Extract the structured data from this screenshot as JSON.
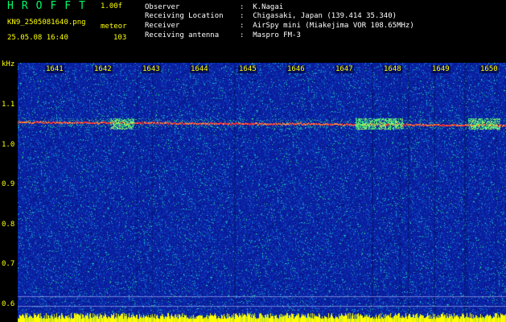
{
  "header": {
    "app_title": "HROFFT",
    "version": "1.00f",
    "filename": "KN9_2505081640.png",
    "mode": "meteor",
    "datetime": "25.05.08 16:40",
    "count": "103"
  },
  "info": [
    {
      "label": "Observer",
      "value": ":  K.Nagai"
    },
    {
      "label": "Receiving Location",
      "value": ":  Chigasaki, Japan (139.414 35.340)"
    },
    {
      "label": "Receiver",
      "value": ":  AirSpy mini (Miakejima VOR 108.65MHz)"
    },
    {
      "label": "Receiving antenna",
      "value": ":  Maspro FM-3"
    }
  ],
  "axis": {
    "y_unit": "kHz",
    "x_ticks": [
      "1641",
      "1642",
      "1643",
      "1644",
      "1645",
      "1646",
      "1647",
      "1648",
      "1649",
      "1650"
    ],
    "y_ticks": [
      "1.1",
      "1.0",
      "0.9",
      "0.8",
      "0.7",
      "0.6"
    ]
  },
  "colors": {
    "background": "#0a1fa0",
    "accent": "#ffff00",
    "carrier": "#ff3030"
  }
}
